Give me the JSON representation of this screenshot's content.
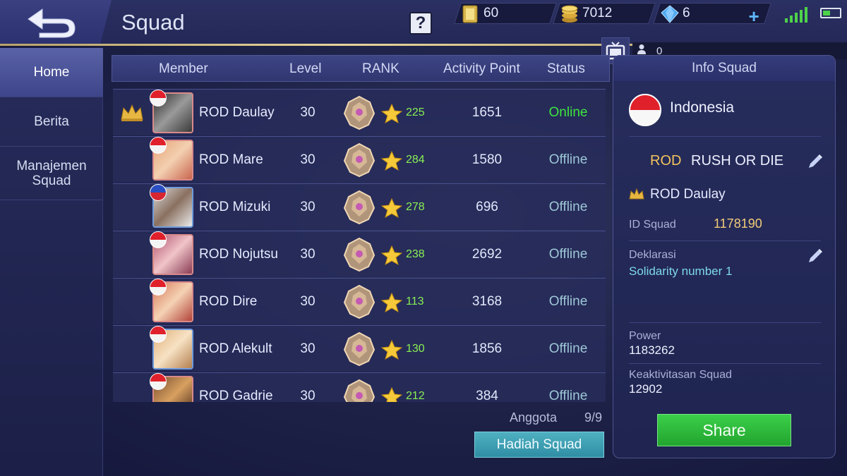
{
  "header": {
    "title": "Squad",
    "help_icon": "?",
    "tickets": "60",
    "gold": "7012",
    "diamonds": "6",
    "online_count": "0"
  },
  "sidebar": {
    "items": [
      {
        "label": "Home",
        "active": true
      },
      {
        "label": "Berita",
        "active": false
      },
      {
        "label": "Manajemen Squad",
        "active": false
      }
    ]
  },
  "table": {
    "headers": {
      "member": "Member",
      "level": "Level",
      "rank": "RANK",
      "activity": "Activity Point",
      "status": "Status"
    },
    "rows": [
      {
        "name": "ROD Daulay",
        "level": "30",
        "stars": "225",
        "activity": "1651",
        "status": "Online",
        "leader": true
      },
      {
        "name": "ROD Mare",
        "level": "30",
        "stars": "284",
        "activity": "1580",
        "status": "Offline"
      },
      {
        "name": "ROD Mizuki",
        "level": "30",
        "stars": "278",
        "activity": "696",
        "status": "Offline"
      },
      {
        "name": "ROD Nojutsu",
        "level": "30",
        "stars": "238",
        "activity": "2692",
        "status": "Offline"
      },
      {
        "name": "ROD Dire",
        "level": "30",
        "stars": "113",
        "activity": "3168",
        "status": "Offline"
      },
      {
        "name": "ROD Alekult",
        "level": "30",
        "stars": "130",
        "activity": "1856",
        "status": "Offline"
      },
      {
        "name": "ROD Gadrie",
        "level": "30",
        "stars": "212",
        "activity": "384",
        "status": "Offline"
      }
    ]
  },
  "footer": {
    "anggota_label": "Anggota",
    "anggota_count": "9/9",
    "hadiah_button": "Hadiah Squad"
  },
  "info": {
    "title": "Info Squad",
    "country": "Indonesia",
    "tag": "ROD",
    "squad_name": "RUSH OR DIE",
    "leader": "ROD Daulay",
    "id_label": "ID Squad",
    "id_value": "1178190",
    "declaration_label": "Deklarasi",
    "declaration_value": "Solidarity number 1",
    "power_label": "Power",
    "power_value": "1183262",
    "activity_label": "Keaktivitasan Squad",
    "activity_value": "12902",
    "share_button": "Share"
  },
  "colors": {
    "online": "#3ee43e",
    "offline": "#9dc7d6",
    "stars": "#8af054",
    "squad_tag": "#f2c35c",
    "share_green": "#22a42e",
    "hadiah_teal": "#2f8ea4"
  },
  "icons": [
    "back-arrow-icon",
    "help-icon",
    "ticket-icon",
    "gold-coin-icon",
    "diamond-icon",
    "plus-icon",
    "signal-icon",
    "battery-icon",
    "tv-icon",
    "person-icon",
    "crown-icon",
    "rank-emblem-icon",
    "star-icon",
    "pencil-icon",
    "flag-icon"
  ]
}
